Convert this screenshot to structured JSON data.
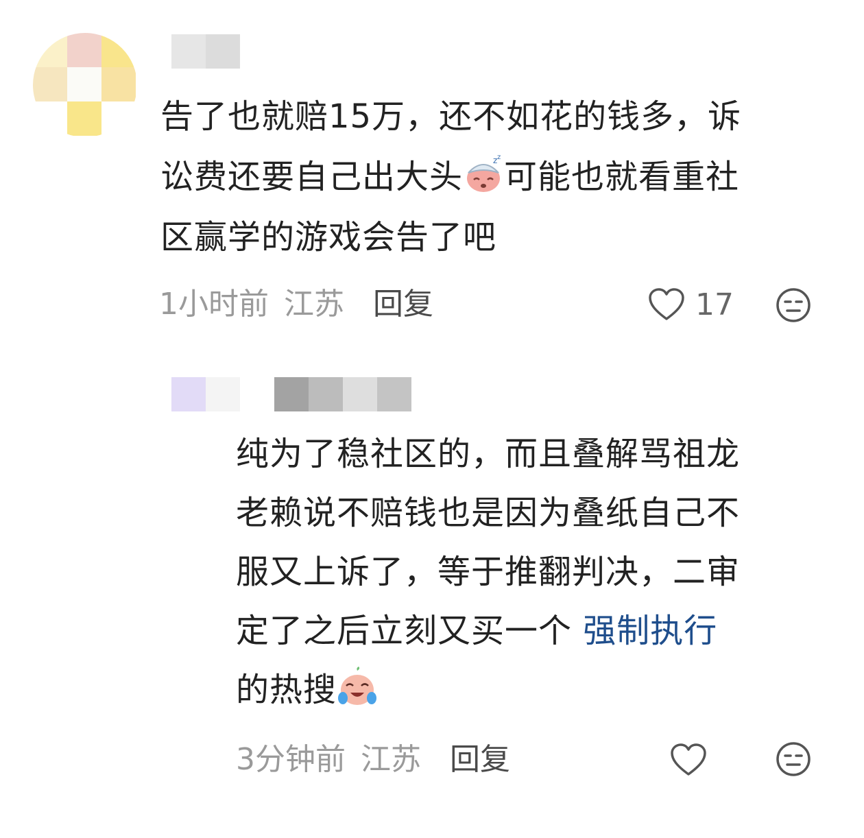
{
  "comment1": {
    "lines": [
      "告了也就赔15万，还不如花的钱多，诉",
      "讼费还要自己出大头",
      "可能也就看重社",
      "区赢学的游戏会告了吧"
    ],
    "emoji": "sleepy-sick-face-icon",
    "time": "1小时前",
    "location": "江苏",
    "reply_label": "回复",
    "like_count": "17"
  },
  "comment2": {
    "lines": [
      "纯为了稳社区的，而且叠解骂祖龙",
      "老赖说不赔钱也是因为叠纸自己不",
      "服又上诉了，等于推翻判决，二审",
      "定了之后立刻又买一个"
    ],
    "link_text": "强制执行",
    "line5": "的热搜",
    "emoji": "laughing-crying-face-icon",
    "time": "3分钟前",
    "location": "江苏",
    "reply_label": "回复"
  },
  "colors": {
    "text": "#222222",
    "meta": "#9a9a9a",
    "link": "#1f4e8c",
    "icon": "#555555"
  }
}
